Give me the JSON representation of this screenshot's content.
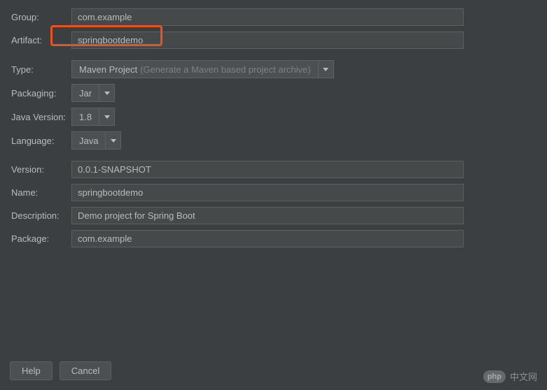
{
  "labels": {
    "group": "Group:",
    "artifact": "Artifact:",
    "type": "Type:",
    "packaging": "Packaging:",
    "javaVersion": "Java Version:",
    "language": "Language:",
    "version": "Version:",
    "name": "Name:",
    "description": "Description:",
    "package": "Package:"
  },
  "values": {
    "group": "com.example",
    "artifact": "springbootdemo",
    "typeMain": "Maven Project",
    "typeHint": "(Generate a Maven based project archive)",
    "packaging": "Jar",
    "javaVersion": "1.8",
    "language": "Java",
    "version": "0.0.1-SNAPSHOT",
    "name": "springbootdemo",
    "description": "Demo project for Spring Boot",
    "package": "com.example"
  },
  "buttons": {
    "help": "Help",
    "cancel": "Cancel"
  },
  "watermark": {
    "badge": "php",
    "text": "中文网"
  }
}
